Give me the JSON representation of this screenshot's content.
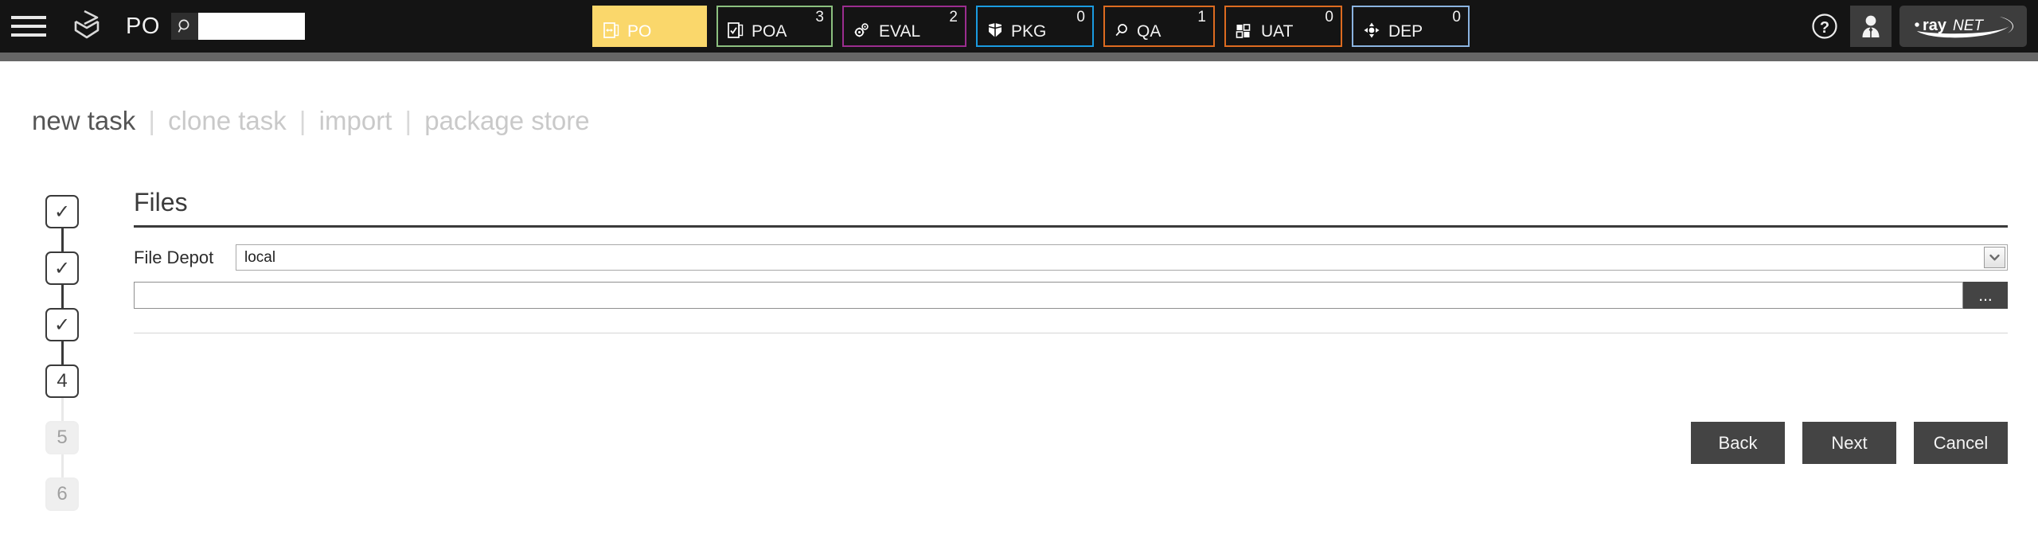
{
  "header": {
    "menu_icon": "hamburger-menu-icon",
    "logo_icon": "raynet-deploy-logo-icon",
    "module_label": "PO",
    "search": {
      "icon": "search-icon",
      "value": "",
      "placeholder": ""
    },
    "tabs": [
      {
        "id": "po",
        "label": "PO",
        "count": "",
        "icon": "package-order-icon",
        "color": "#FAD76B",
        "active": true
      },
      {
        "id": "poa",
        "label": "POA",
        "count": "3",
        "icon": "order-approval-icon",
        "color": "#8CC07F",
        "active": false
      },
      {
        "id": "eval",
        "label": "EVAL",
        "count": "2",
        "icon": "gears-icon",
        "color": "#9B2D8F",
        "active": false
      },
      {
        "id": "pkg",
        "label": "PKG",
        "count": "0",
        "icon": "package-box-icon",
        "color": "#1A9BE0",
        "active": false
      },
      {
        "id": "qa",
        "label": "QA",
        "count": "1",
        "icon": "magnifier-icon",
        "color": "#DD6B20",
        "active": false
      },
      {
        "id": "uat",
        "label": "UAT",
        "count": "0",
        "icon": "checklist-grid-icon",
        "color": "#DD6B20",
        "active": false
      },
      {
        "id": "dep",
        "label": "DEP",
        "count": "0",
        "icon": "deploy-target-icon",
        "color": "#8BB4E0",
        "active": false
      }
    ],
    "help_icon": "question-mark-help-icon",
    "user_icon": "user-account-icon",
    "brand": {
      "dot": "•",
      "ray": "ray",
      "net": "NET"
    }
  },
  "breadcrumb": {
    "items": [
      {
        "label": "new task",
        "active": true
      },
      {
        "label": "clone task",
        "active": false
      },
      {
        "label": "import",
        "active": false
      },
      {
        "label": "package store",
        "active": false
      }
    ],
    "separator": "|"
  },
  "stepper": {
    "check_glyph": "✓",
    "steps": [
      {
        "label": "✓",
        "state": "done"
      },
      {
        "label": "✓",
        "state": "done"
      },
      {
        "label": "✓",
        "state": "done"
      },
      {
        "label": "4",
        "state": "current"
      },
      {
        "label": "5",
        "state": "todo"
      },
      {
        "label": "6",
        "state": "todo"
      }
    ]
  },
  "panel": {
    "title": "Files",
    "file_depot": {
      "label": "File Depot",
      "value": "local",
      "options": [
        "local"
      ],
      "arrow_icon": "chevron-down-icon"
    },
    "file_path": {
      "value": "",
      "placeholder": "",
      "browse_label": "..."
    }
  },
  "actions": {
    "back": "Back",
    "next": "Next",
    "cancel": "Cancel"
  },
  "colors": {
    "header_bg": "#141414",
    "underbar": "#666666",
    "active_tab": "#FAD76B",
    "button_bg": "#444444",
    "text_dark": "#3b3b3b"
  }
}
